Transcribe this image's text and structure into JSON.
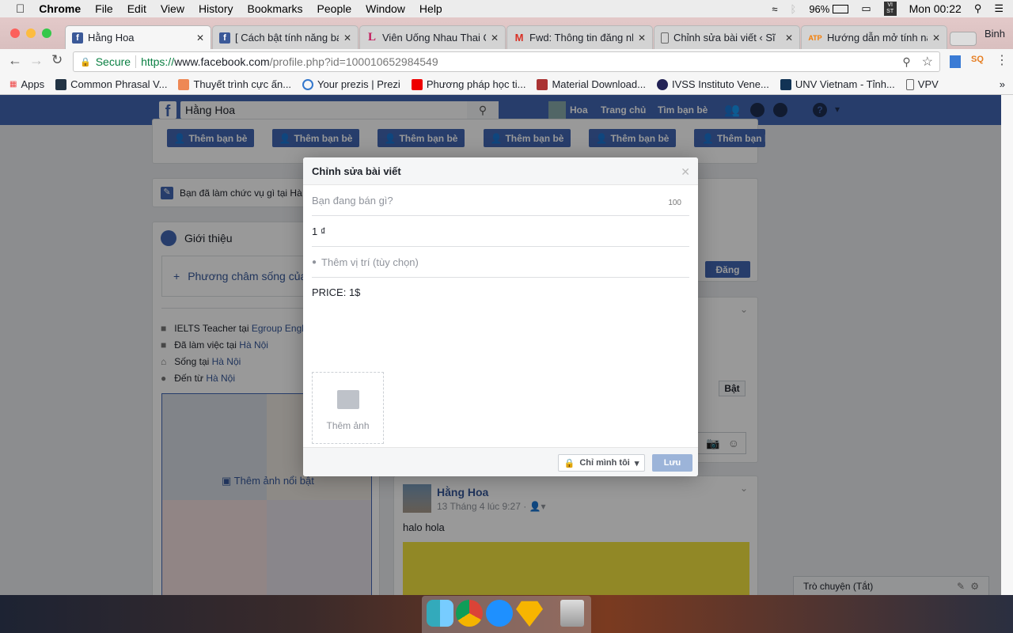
{
  "menubar": {
    "app": "Chrome",
    "items": [
      "File",
      "Edit",
      "View",
      "History",
      "Bookmarks",
      "People",
      "Window",
      "Help"
    ],
    "battery": "96%",
    "clock": "Mon 00:22",
    "input_source": "VI ST"
  },
  "browser": {
    "tabs": [
      {
        "title": "Hằng Hoa",
        "icon": "facebook",
        "active": true
      },
      {
        "title": "[ Cách bật tính năng bá",
        "icon": "facebook"
      },
      {
        "title": "Viên Uống Nhau Thai C",
        "icon": "L-logo"
      },
      {
        "title": "Fwd: Thông tin đăng nh",
        "icon": "gmail"
      },
      {
        "title": "Chỉnh sửa bài viết ‹ Sĩ",
        "icon": "document"
      },
      {
        "title": "Hướng dẫn mở tính năn",
        "icon": "ATP"
      }
    ],
    "profile_name": "Binh",
    "secure_label": "Secure",
    "url_scheme": "https://",
    "url_host": "www.facebook.com",
    "url_path": "/profile.php?id=100010652984549",
    "bookmarks": [
      "Apps",
      "Common Phrasal V...",
      "Thuyết trình cực ấn...",
      "Your prezis | Prezi",
      "Phương pháp học ti...",
      "Material Download...",
      "IVSS Instituto Vene...",
      "UNV Vietnam - Tỉnh...",
      "VPV"
    ]
  },
  "fb": {
    "search_value": "Hằng Hoa",
    "nav": [
      "Hoa",
      "Trang chủ",
      "Tìm bạn bè"
    ],
    "add_friend_label": "Thêm bạn bè",
    "work_prompt": "Bạn đã làm chức vụ gì tại Hà Nội",
    "work_prompt_tail": "ời",
    "intro_title": "Giới thiệu",
    "motto_prompt": "Phương châm sống của b",
    "intro_items": [
      {
        "icon": "briefcase",
        "text": "IELTS Teacher tại ",
        "link": "Egroup English"
      },
      {
        "icon": "briefcase",
        "text": "Đã làm việc tại ",
        "link": "Hà Nội"
      },
      {
        "icon": "home",
        "text": "Sống tại ",
        "link": "Hà Nội"
      },
      {
        "icon": "pin",
        "text": "Đến từ ",
        "link": "Hà Nội"
      }
    ],
    "featured_photos_label": "Thêm ảnh nổi bật",
    "post_button": "Đăng",
    "turn_on_button": "Bật",
    "post": {
      "author": "Hằng Hoa",
      "date": "13 Tháng 4 lúc 9:27 ·",
      "text": "halo hola"
    },
    "chat": "Trò chuyện (Tắt)"
  },
  "modal": {
    "title": "Chỉnh sửa bài viết",
    "item_placeholder": "Bạn đang bán gì?",
    "char_count": "100",
    "price_value": "1 ₫",
    "location_placeholder": "Thêm vị trí (tùy chọn)",
    "description_value": "PRICE: 1$",
    "add_photo_label": "Thêm ảnh",
    "privacy_label": "Chỉ mình tôi",
    "save_label": "Lưu"
  },
  "colors": {
    "fb_blue": "#4267b2",
    "save_disabled": "#9cb4d9",
    "link": "#365899"
  }
}
